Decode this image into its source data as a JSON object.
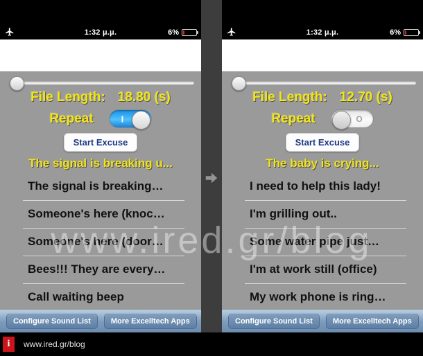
{
  "statusbar": {
    "airplane_icon": "airplane-icon",
    "time": "1:32 μ.μ.",
    "battery_percent": "6%",
    "battery_icon": "battery-low-icon"
  },
  "panels": [
    {
      "id": "left",
      "file_length_label": "File Length:",
      "file_length_value": "18.80 (s)",
      "repeat_label": "Repeat",
      "repeat_state": "on",
      "repeat_mark": "I",
      "start_button": "Start Excuse",
      "current_title": "The signal is breaking u...",
      "items": [
        "The signal is breaking…",
        "Someone's here (knoc…",
        "Someone's here (door…",
        "Bees!!! They are every…",
        "Call waiting beep"
      ],
      "toolbar": {
        "configure": "Configure Sound List",
        "more_apps": "More Excelltech Apps"
      }
    },
    {
      "id": "right",
      "file_length_label": "File Length:",
      "file_length_value": "12.70 (s)",
      "repeat_label": "Repeat",
      "repeat_state": "off",
      "repeat_mark": "O",
      "start_button": "Start Excuse",
      "current_title": "The baby is crying...",
      "items": [
        "I need to help this lady!",
        "I'm grilling out..",
        "Some water pipe just…",
        "I'm at work still (office)",
        "My work phone is ring…"
      ],
      "toolbar": {
        "configure": "Configure Sound List",
        "more_apps": "More Excelltech Apps"
      }
    }
  ],
  "transition_arrow": "arrow-right-icon",
  "watermark": "www.ired.gr/blog",
  "footer": {
    "logo_letter": "i",
    "url": "www.ired.gr/blog"
  },
  "colors": {
    "accent_yellow": "#f2e515",
    "toggle_on_blue": "#4fc2fb",
    "app_background": "#9a9a9a",
    "toolbar_blue": "#7e9cbd",
    "logo_red": "#c9151b",
    "button_text_navy": "#1f3a87"
  }
}
